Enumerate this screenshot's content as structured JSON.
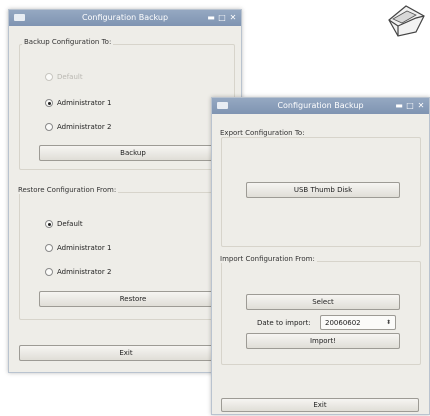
{
  "window1": {
    "title": "Configuration Backup",
    "backup_group": {
      "label": "Backup Configuration To:",
      "options": [
        {
          "label": "Default",
          "checked": false,
          "disabled": true
        },
        {
          "label": "Administrator 1",
          "checked": true,
          "disabled": false
        },
        {
          "label": "Administrator 2",
          "checked": false,
          "disabled": false
        }
      ],
      "button": "Backup"
    },
    "restore_group": {
      "label": "Restore Configuration From:",
      "options": [
        {
          "label": "Default",
          "checked": true,
          "disabled": false
        },
        {
          "label": "Administrator 1",
          "checked": false,
          "disabled": false
        },
        {
          "label": "Administrator 2",
          "checked": false,
          "disabled": false
        }
      ],
      "button": "Restore"
    },
    "exit_button": "Exit"
  },
  "window2": {
    "title": "Configuration Backup",
    "export_group": {
      "label": "Export Configuration To:",
      "button": "USB Thumb Disk"
    },
    "import_group": {
      "label": "Import Configuration From:",
      "select_button": "Select",
      "date_label": "Date to import:",
      "date_value": "20060602",
      "import_button": "Import!"
    },
    "exit_button": "Exit"
  },
  "icons": {
    "usb_drive": "usb-drive-icon"
  }
}
